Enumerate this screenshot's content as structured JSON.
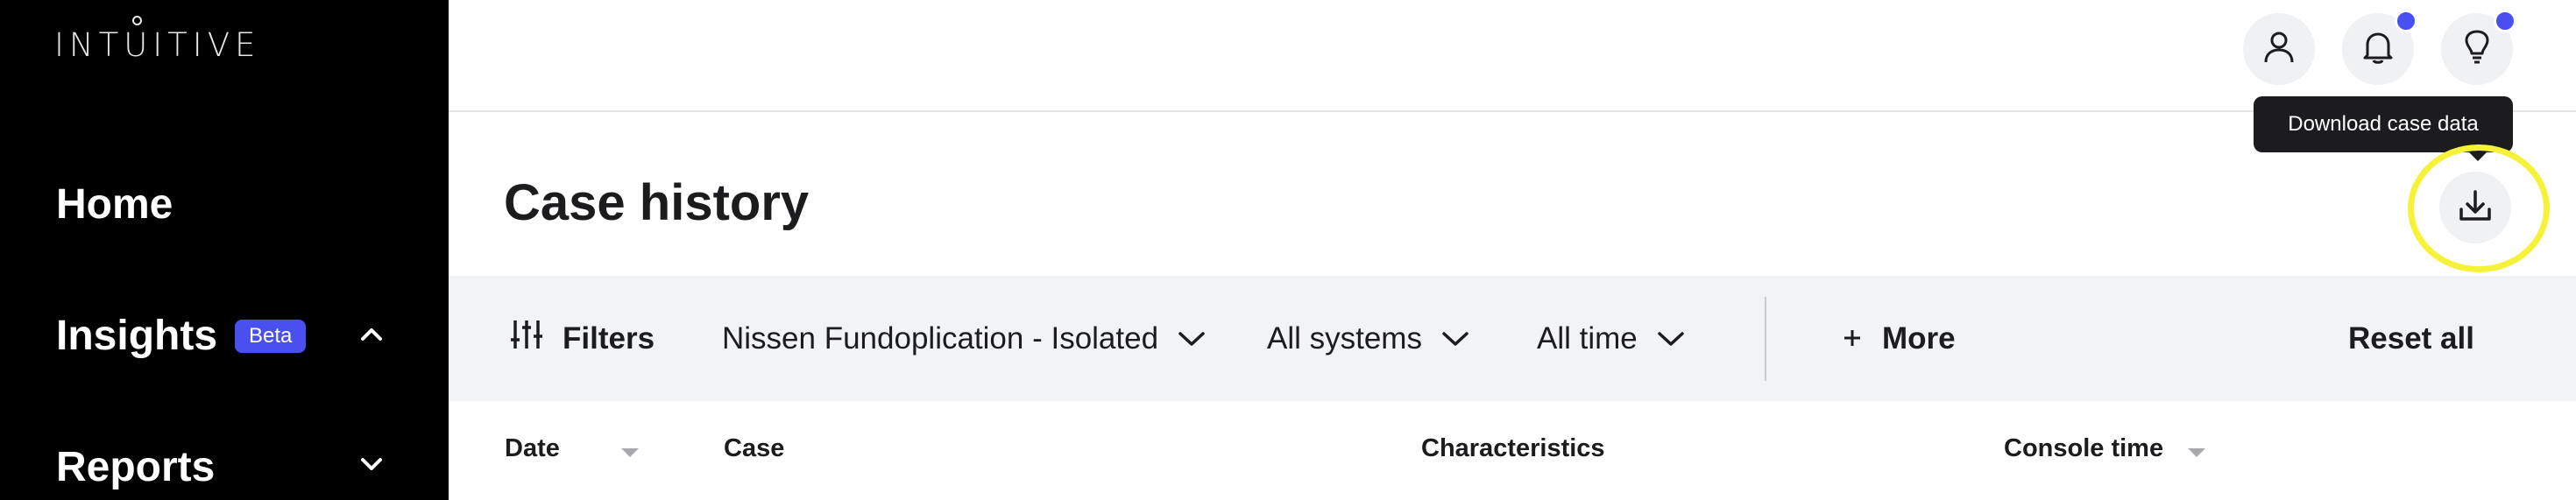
{
  "sidebar": {
    "logo": "INTUITIVE",
    "items": [
      {
        "label": "Home"
      },
      {
        "label": "Insights",
        "badge": "Beta",
        "expanded": true
      },
      {
        "label": "Reports",
        "expanded": false
      }
    ]
  },
  "topbar": {
    "buttons": [
      {
        "icon": "user-icon",
        "has_notification": false
      },
      {
        "icon": "bell-icon",
        "has_notification": true
      },
      {
        "icon": "lightbulb-icon",
        "has_notification": true
      }
    ]
  },
  "tooltip": {
    "text": "Download case data"
  },
  "page": {
    "title": "Case history",
    "download_icon": "download-icon"
  },
  "filters": {
    "filters_label": "Filters",
    "procedure": "Nissen Fundoplication - Isolated",
    "systems": "All systems",
    "time": "All time",
    "more_label": "More",
    "reset_label": "Reset all"
  },
  "table": {
    "columns": [
      "Date",
      "Case",
      "Characteristics",
      "Console time"
    ]
  },
  "colors": {
    "accent": "#4a4fef",
    "highlight": "#f6f23a",
    "sidebar_bg": "#000000",
    "filterbar_bg": "#f2f3f5"
  }
}
